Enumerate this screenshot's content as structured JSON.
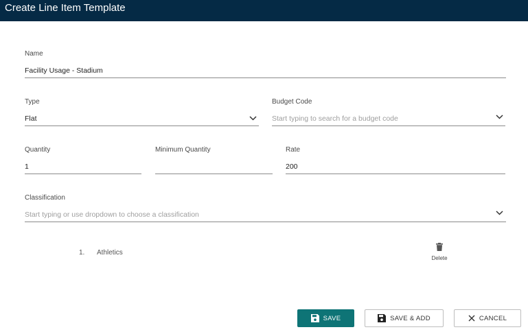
{
  "dialog": {
    "title": "Create Line Item Template"
  },
  "fields": {
    "name": {
      "label": "Name",
      "value": "Facility Usage - Stadium"
    },
    "type": {
      "label": "Type",
      "value": "Flat"
    },
    "budget_code": {
      "label": "Budget Code",
      "placeholder": "Start typing to search for a budget code"
    },
    "quantity": {
      "label": "Quantity",
      "value": "1"
    },
    "minimum_quantity": {
      "label": "Minimum Quantity",
      "value": ""
    },
    "rate": {
      "label": "Rate",
      "value": "200"
    },
    "classification": {
      "label": "Classification",
      "placeholder": "Start typing or use dropdown to choose a classification"
    }
  },
  "classifications": [
    {
      "index": "1.",
      "name": "Athletics",
      "delete_label": "Delete"
    }
  ],
  "buttons": {
    "save": "SAVE",
    "save_add": "SAVE & ADD",
    "cancel": "CANCEL"
  },
  "colors": {
    "header_bg": "#052a45",
    "primary": "#0e7476"
  },
  "icons": {
    "dropdown": "chevron-down-icon",
    "delete": "trash-icon",
    "save": "floppy-disk-icon",
    "cancel": "close-icon"
  }
}
